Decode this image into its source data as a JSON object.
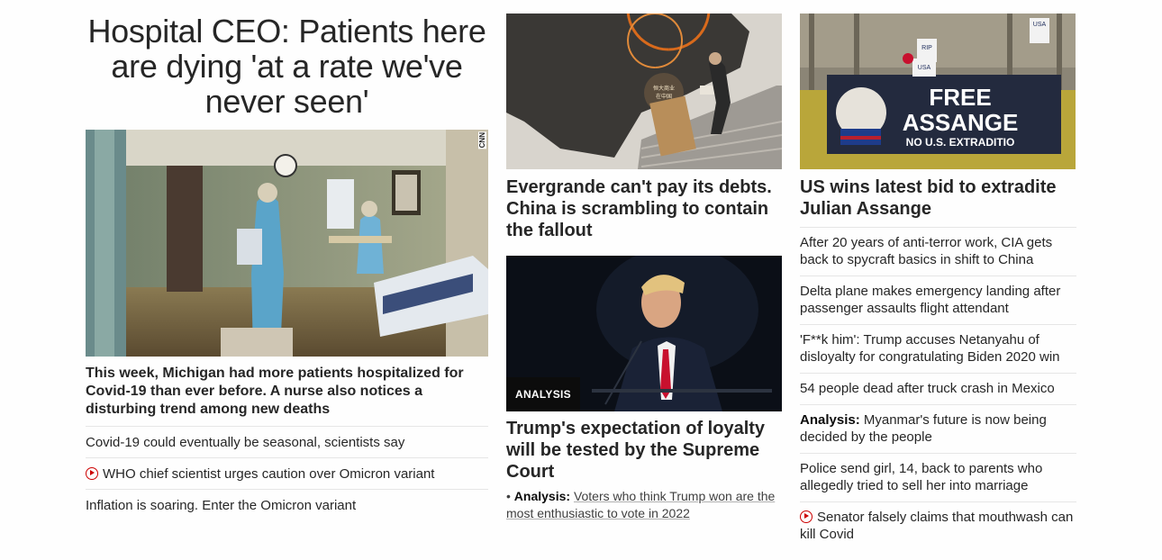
{
  "col1": {
    "headline": "Hospital CEO: Patients here are dying 'at a rate we've never seen'",
    "image_watermark": "CNN",
    "subhead": "This week, Michigan had more patients hospitalized for Covid-19 than ever before. A nurse also notices a disturbing trend among new deaths",
    "links": [
      {
        "text": "Covid-19 could eventually be seasonal, scientists say",
        "video": false
      },
      {
        "text": "WHO chief scientist urges caution over Omicron variant",
        "video": true
      },
      {
        "text": "Inflation is soaring. Enter the Omicron variant",
        "video": false
      }
    ]
  },
  "col2": {
    "story1_title": "Evergrande can't pay its debts. China is scrambling to contain the fallout",
    "story1_sign": "恒大商业 在中国",
    "story2_badge": "ANALYSIS",
    "story2_title": "Trump's expectation of loyalty will be tested by the Supreme Court",
    "story2_bullet": "•",
    "story2_lead": "Analysis:",
    "story2_link": "Voters who think Trump won are the most enthusiastic to vote in 2022"
  },
  "col3": {
    "story_title": "US wins latest bid to extradite Julian Assange",
    "banner_line1": "FREE",
    "banner_line2": "ASSANGE",
    "banner_line3": "NO U.S. EXTRADITIO",
    "sign1": "USA",
    "sign2": "RIP",
    "sign3": "USA",
    "links": [
      {
        "lead": "",
        "text": "After 20 years of anti-terror work, CIA gets back to spycraft basics in shift to China",
        "video": false
      },
      {
        "lead": "",
        "text": "Delta plane makes emergency landing after passenger assaults flight attendant",
        "video": false
      },
      {
        "lead": "",
        "text": "'F**k him': Trump accuses Netanyahu of disloyalty for congratulating Biden 2020 win",
        "video": false
      },
      {
        "lead": "",
        "text": "54 people dead after truck crash in Mexico",
        "video": false
      },
      {
        "lead": "Analysis:",
        "text": " Myanmar's future is now being decided by the people",
        "video": false
      },
      {
        "lead": "",
        "text": "Police send girl, 14, back to parents who allegedly tried to sell her into marriage",
        "video": false
      },
      {
        "lead": "",
        "text": "Senator falsely claims that mouthwash can kill Covid",
        "video": true
      }
    ]
  },
  "colors": {
    "accent": "#cc0000",
    "divider": "#e6e6e6",
    "text": "#262626"
  }
}
